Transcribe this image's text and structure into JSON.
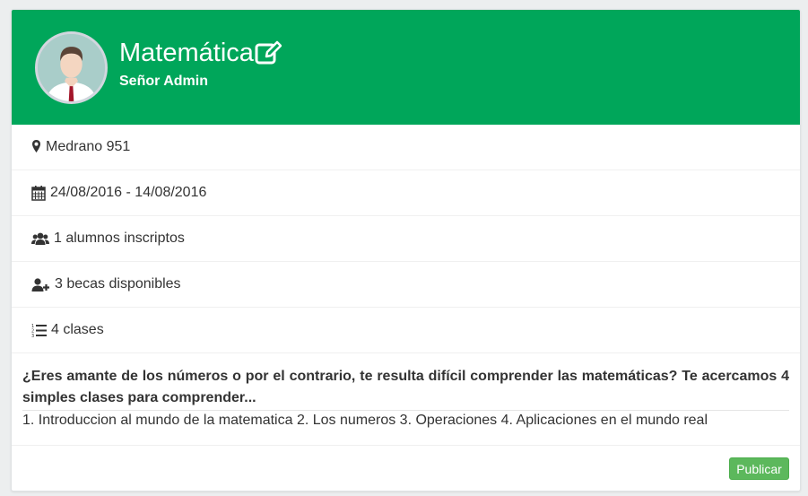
{
  "course": {
    "title": "Matemática",
    "owner": "Señor Admin"
  },
  "details": [
    {
      "icon": "map-marker-icon",
      "text": "Medrano 951"
    },
    {
      "icon": "calendar-icon",
      "text": "24/08/2016 - 14/08/2016"
    },
    {
      "icon": "users-icon",
      "text": "1 alumnos inscriptos"
    },
    {
      "icon": "user-plus-icon",
      "text": "3 becas disponibles"
    },
    {
      "icon": "list-ol-icon",
      "text": "4 clases"
    }
  ],
  "description": {
    "title": "¿Eres amante de los números o por el contrario, te resulta difícil comprender las matemáticas? Te acercamos 4 simples clases para comprender...",
    "body": "1. Introduccion al mundo de la matematica 2. Los numeros 3. Operaciones 4. Aplicaciones en el mundo real"
  },
  "actions": {
    "publish_label": "Publicar"
  },
  "colors": {
    "header": "#00a65a",
    "publish_button": "#5cb85c"
  }
}
